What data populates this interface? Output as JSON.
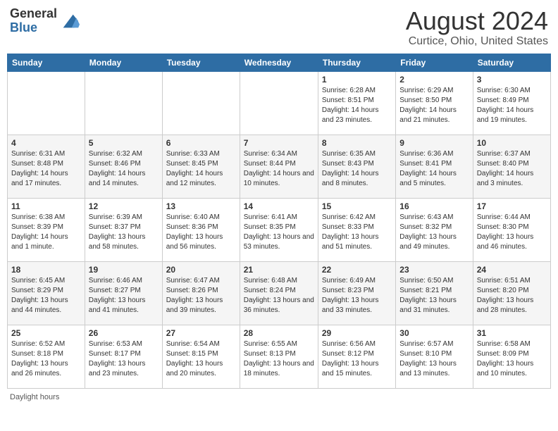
{
  "header": {
    "logo_general": "General",
    "logo_blue": "Blue",
    "month_title": "August 2024",
    "location": "Curtice, Ohio, United States"
  },
  "days_of_week": [
    "Sunday",
    "Monday",
    "Tuesday",
    "Wednesday",
    "Thursday",
    "Friday",
    "Saturday"
  ],
  "footer": {
    "daylight_hours": "Daylight hours"
  },
  "weeks": [
    [
      {
        "day": "",
        "info": ""
      },
      {
        "day": "",
        "info": ""
      },
      {
        "day": "",
        "info": ""
      },
      {
        "day": "",
        "info": ""
      },
      {
        "day": "1",
        "info": "Sunrise: 6:28 AM\nSunset: 8:51 PM\nDaylight: 14 hours and 23 minutes."
      },
      {
        "day": "2",
        "info": "Sunrise: 6:29 AM\nSunset: 8:50 PM\nDaylight: 14 hours and 21 minutes."
      },
      {
        "day": "3",
        "info": "Sunrise: 6:30 AM\nSunset: 8:49 PM\nDaylight: 14 hours and 19 minutes."
      }
    ],
    [
      {
        "day": "4",
        "info": "Sunrise: 6:31 AM\nSunset: 8:48 PM\nDaylight: 14 hours and 17 minutes."
      },
      {
        "day": "5",
        "info": "Sunrise: 6:32 AM\nSunset: 8:46 PM\nDaylight: 14 hours and 14 minutes."
      },
      {
        "day": "6",
        "info": "Sunrise: 6:33 AM\nSunset: 8:45 PM\nDaylight: 14 hours and 12 minutes."
      },
      {
        "day": "7",
        "info": "Sunrise: 6:34 AM\nSunset: 8:44 PM\nDaylight: 14 hours and 10 minutes."
      },
      {
        "day": "8",
        "info": "Sunrise: 6:35 AM\nSunset: 8:43 PM\nDaylight: 14 hours and 8 minutes."
      },
      {
        "day": "9",
        "info": "Sunrise: 6:36 AM\nSunset: 8:41 PM\nDaylight: 14 hours and 5 minutes."
      },
      {
        "day": "10",
        "info": "Sunrise: 6:37 AM\nSunset: 8:40 PM\nDaylight: 14 hours and 3 minutes."
      }
    ],
    [
      {
        "day": "11",
        "info": "Sunrise: 6:38 AM\nSunset: 8:39 PM\nDaylight: 14 hours and 1 minute."
      },
      {
        "day": "12",
        "info": "Sunrise: 6:39 AM\nSunset: 8:37 PM\nDaylight: 13 hours and 58 minutes."
      },
      {
        "day": "13",
        "info": "Sunrise: 6:40 AM\nSunset: 8:36 PM\nDaylight: 13 hours and 56 minutes."
      },
      {
        "day": "14",
        "info": "Sunrise: 6:41 AM\nSunset: 8:35 PM\nDaylight: 13 hours and 53 minutes."
      },
      {
        "day": "15",
        "info": "Sunrise: 6:42 AM\nSunset: 8:33 PM\nDaylight: 13 hours and 51 minutes."
      },
      {
        "day": "16",
        "info": "Sunrise: 6:43 AM\nSunset: 8:32 PM\nDaylight: 13 hours and 49 minutes."
      },
      {
        "day": "17",
        "info": "Sunrise: 6:44 AM\nSunset: 8:30 PM\nDaylight: 13 hours and 46 minutes."
      }
    ],
    [
      {
        "day": "18",
        "info": "Sunrise: 6:45 AM\nSunset: 8:29 PM\nDaylight: 13 hours and 44 minutes."
      },
      {
        "day": "19",
        "info": "Sunrise: 6:46 AM\nSunset: 8:27 PM\nDaylight: 13 hours and 41 minutes."
      },
      {
        "day": "20",
        "info": "Sunrise: 6:47 AM\nSunset: 8:26 PM\nDaylight: 13 hours and 39 minutes."
      },
      {
        "day": "21",
        "info": "Sunrise: 6:48 AM\nSunset: 8:24 PM\nDaylight: 13 hours and 36 minutes."
      },
      {
        "day": "22",
        "info": "Sunrise: 6:49 AM\nSunset: 8:23 PM\nDaylight: 13 hours and 33 minutes."
      },
      {
        "day": "23",
        "info": "Sunrise: 6:50 AM\nSunset: 8:21 PM\nDaylight: 13 hours and 31 minutes."
      },
      {
        "day": "24",
        "info": "Sunrise: 6:51 AM\nSunset: 8:20 PM\nDaylight: 13 hours and 28 minutes."
      }
    ],
    [
      {
        "day": "25",
        "info": "Sunrise: 6:52 AM\nSunset: 8:18 PM\nDaylight: 13 hours and 26 minutes."
      },
      {
        "day": "26",
        "info": "Sunrise: 6:53 AM\nSunset: 8:17 PM\nDaylight: 13 hours and 23 minutes."
      },
      {
        "day": "27",
        "info": "Sunrise: 6:54 AM\nSunset: 8:15 PM\nDaylight: 13 hours and 20 minutes."
      },
      {
        "day": "28",
        "info": "Sunrise: 6:55 AM\nSunset: 8:13 PM\nDaylight: 13 hours and 18 minutes."
      },
      {
        "day": "29",
        "info": "Sunrise: 6:56 AM\nSunset: 8:12 PM\nDaylight: 13 hours and 15 minutes."
      },
      {
        "day": "30",
        "info": "Sunrise: 6:57 AM\nSunset: 8:10 PM\nDaylight: 13 hours and 13 minutes."
      },
      {
        "day": "31",
        "info": "Sunrise: 6:58 AM\nSunset: 8:09 PM\nDaylight: 13 hours and 10 minutes."
      }
    ]
  ]
}
